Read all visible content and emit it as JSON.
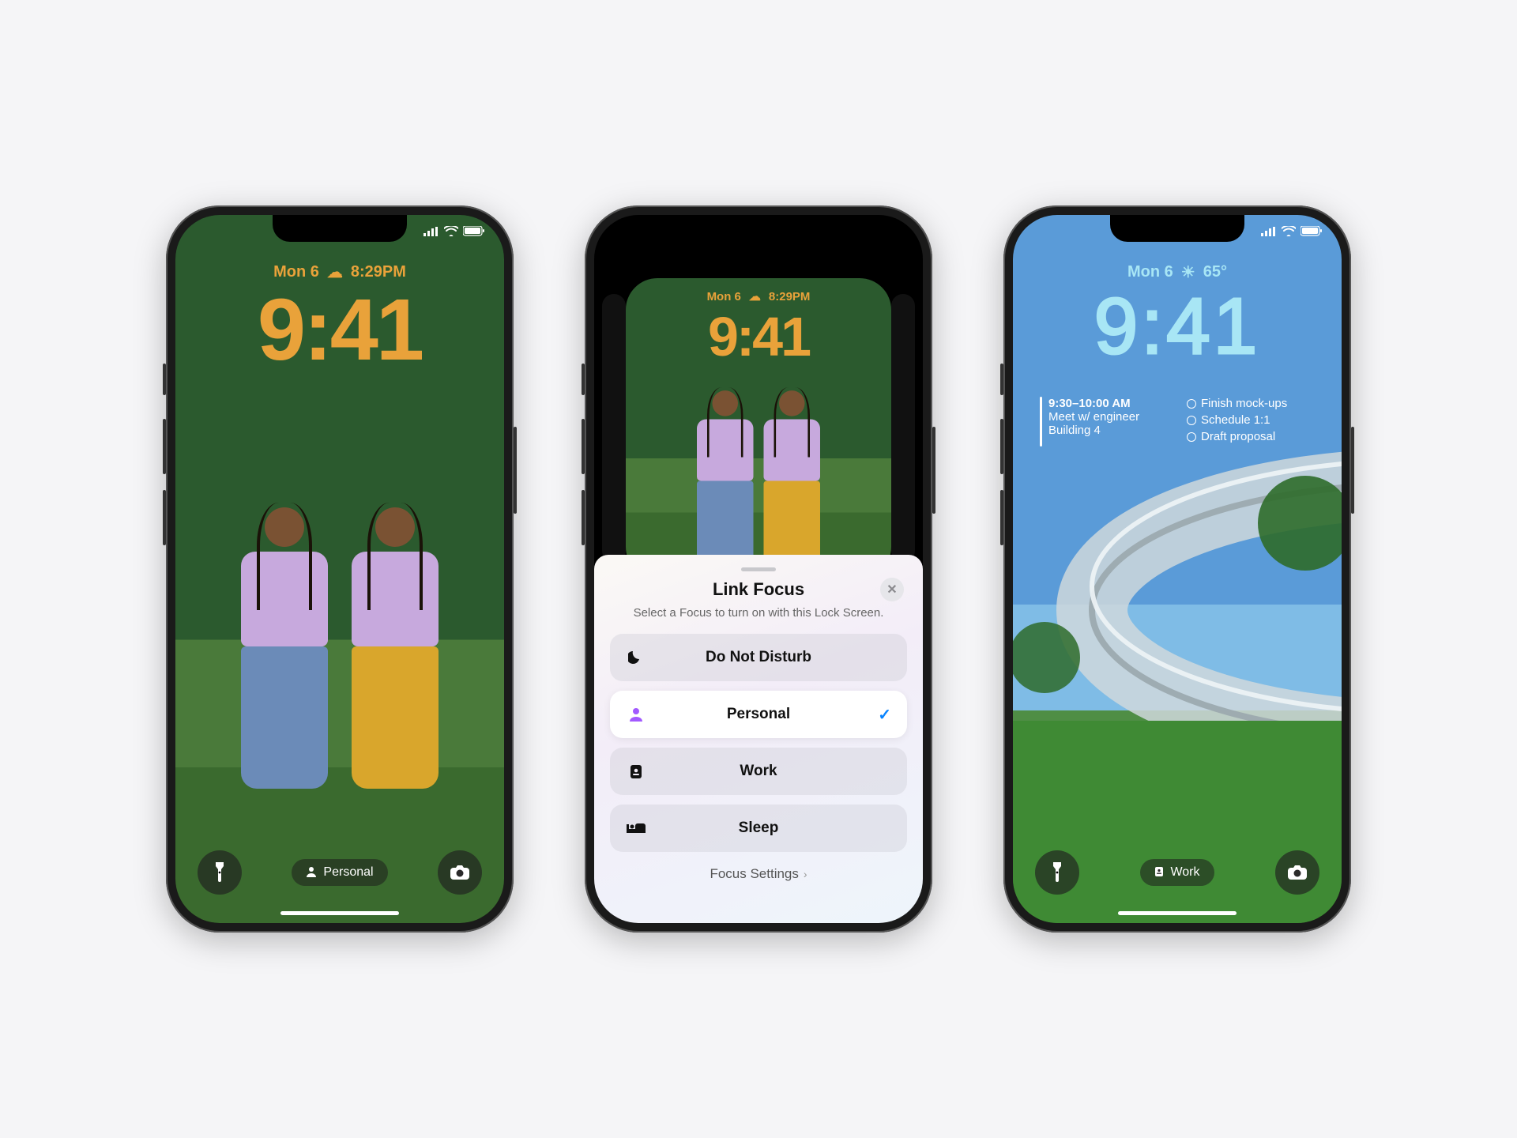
{
  "phone1": {
    "date_label": "Mon 6",
    "weather": "8:29PM",
    "time": "9:41",
    "focus_label": "Personal"
  },
  "phone2": {
    "preview": {
      "date_label": "Mon 6",
      "weather": "8:29PM",
      "time": "9:41"
    },
    "sheet": {
      "title": "Link Focus",
      "subtitle": "Select a Focus to turn on with this Lock Screen.",
      "items": [
        {
          "icon": "moon-icon",
          "label": "Do Not Disturb",
          "selected": false
        },
        {
          "icon": "person-icon",
          "label": "Personal",
          "selected": true
        },
        {
          "icon": "badge-icon",
          "label": "Work",
          "selected": false
        },
        {
          "icon": "bed-icon",
          "label": "Sleep",
          "selected": false
        }
      ],
      "settings_link": "Focus Settings"
    }
  },
  "phone3": {
    "date_label": "Mon 6",
    "weather": "65°",
    "time": "9:41",
    "widgets": {
      "calendar": {
        "time_range": "9:30–10:00 AM",
        "title": "Meet w/ engineer",
        "location": "Building 4"
      },
      "reminders": [
        "Finish mock-ups",
        "Schedule 1:1",
        "Draft proposal"
      ]
    },
    "focus_label": "Work"
  },
  "colors": {
    "accent_orange": "#e9a23a",
    "accent_cyan": "#a8e6f5",
    "ios_blue": "#0a84ff"
  }
}
